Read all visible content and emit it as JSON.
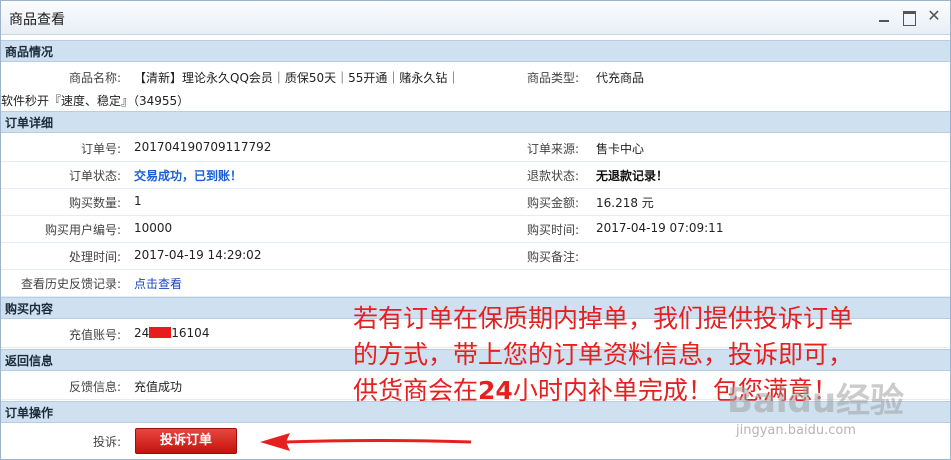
{
  "window": {
    "title": "商品查看"
  },
  "product": {
    "section": "商品情况",
    "name_label": "商品名称:",
    "name_line1": "【清新】理论永久QQ会员｜质保50天｜55开通｜赌永久钻｜",
    "name_line2": "软件秒开『速度、稳定』（34955）",
    "type_label": "商品类型:",
    "type_value": "代充商品"
  },
  "order": {
    "section": "订单详细",
    "rows": [
      {
        "l": "订单号:",
        "v": "201704190709117792",
        "l2": "订单来源:",
        "v2": "售卡中心"
      },
      {
        "l": "订单状态:",
        "v": "交易成功，已到账！",
        "l2": "退款状态:",
        "v2": "无退款记录！"
      },
      {
        "l": "购买数量:",
        "v": "1",
        "l2": "购买金额:",
        "v2": "16.218 元"
      },
      {
        "l": "购买用户编号:",
        "v": "10000",
        "l2": "购买时间:",
        "v2": "2017-04-19 07:09:11"
      },
      {
        "l": "处理时间:",
        "v": "2017-04-19 14:29:02",
        "l2": "购买备注:",
        "v2": ""
      }
    ],
    "history_label": "查看历史反馈记录:",
    "history_link": "点击查看"
  },
  "purchase": {
    "section": "购买内容",
    "account_label": "充值账号:",
    "account_prefix": "24",
    "account_suffix": "16104"
  },
  "feedback": {
    "section": "返回信息",
    "label": "反馈信息:",
    "value": "充值成功"
  },
  "operation": {
    "section": "订单操作",
    "label": "投诉:",
    "button": "投诉订单"
  },
  "annotation": {
    "line1": "若有订单在保质期内掉单，我们提供投诉订单",
    "line2": "的方式，带上您的订单资料信息，投诉即可，",
    "line3_a": "供货商会在",
    "line3_b": "24",
    "line3_c": "小时内补单完成！包您满意！"
  },
  "watermark": {
    "brand": "Baidu经验",
    "url": "jingyan.baidu.com"
  }
}
